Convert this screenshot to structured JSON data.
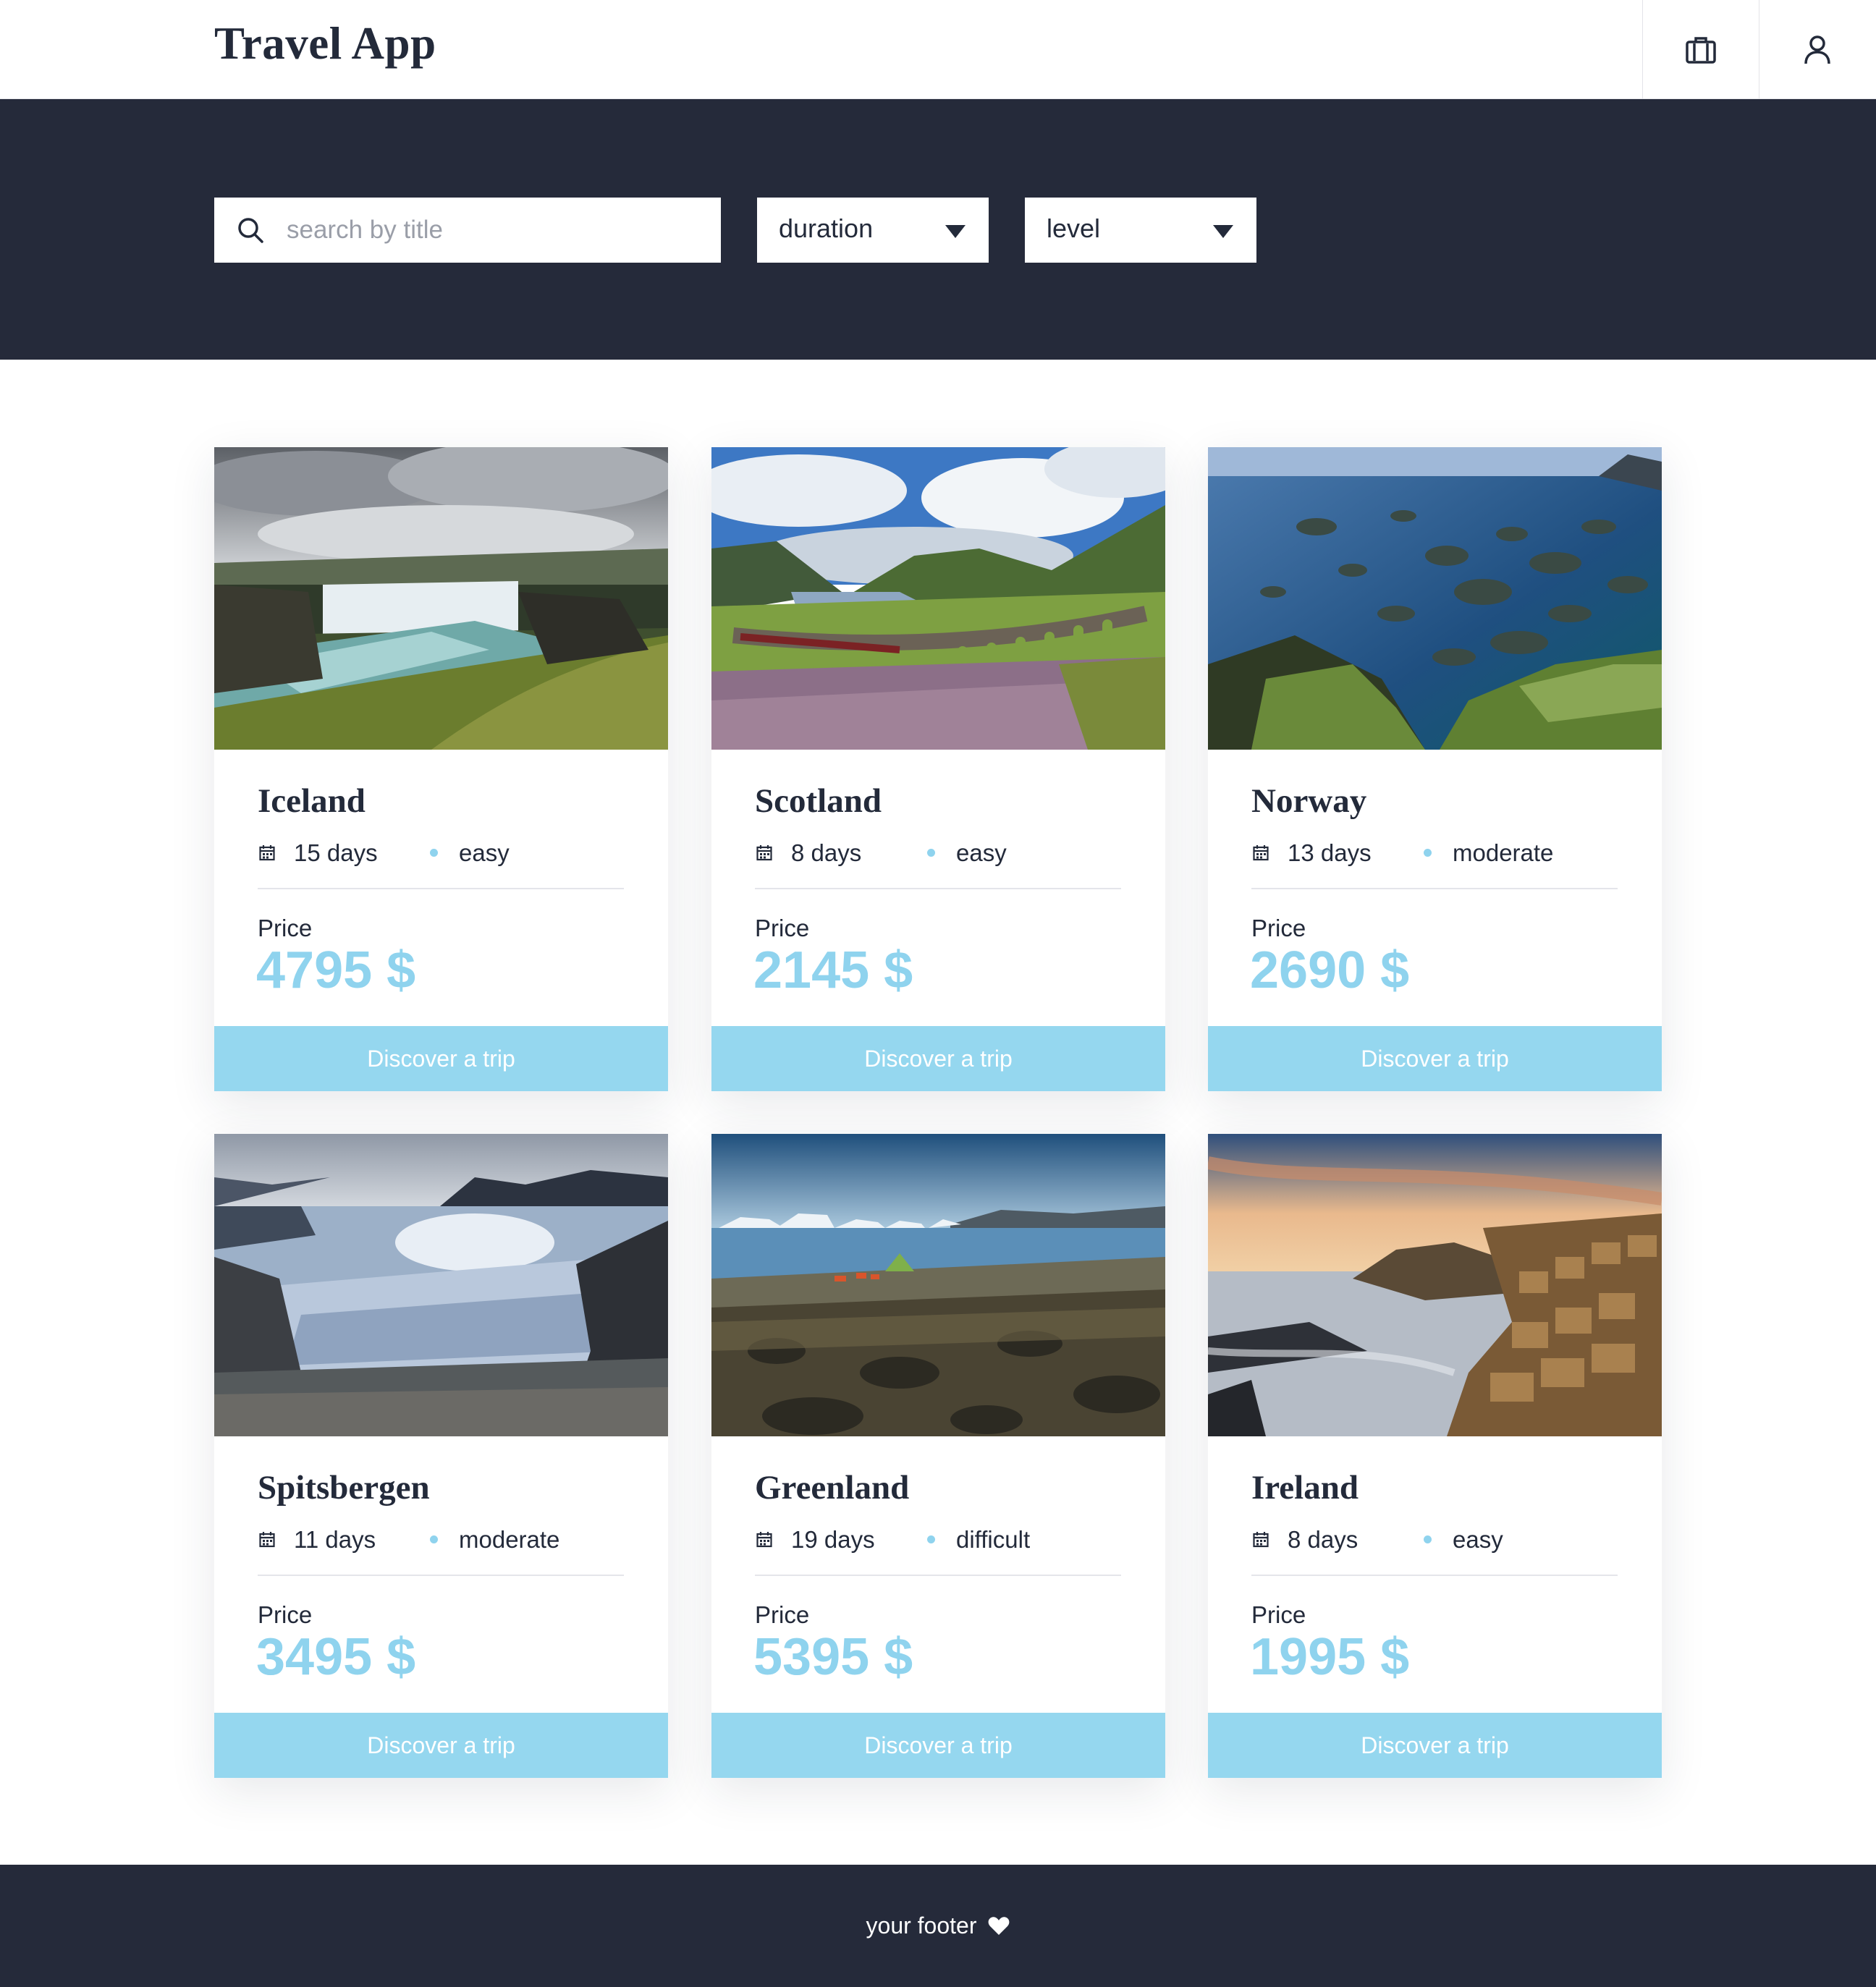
{
  "header": {
    "title": "Travel App",
    "briefcase_icon": "briefcase-icon",
    "user_icon": "user-icon"
  },
  "filters": {
    "search_placeholder": "search by title",
    "duration_label": "duration",
    "level_label": "level"
  },
  "colors": {
    "dark": "#252a3a",
    "accent": "#95d7ef",
    "price": "#8fd3ee"
  },
  "trips": [
    {
      "title": "Iceland",
      "days": "15 days",
      "level": "easy",
      "price_label": "Price",
      "price": "4795 $",
      "cta": "Discover a trip"
    },
    {
      "title": "Scotland",
      "days": "8 days",
      "level": "easy",
      "price_label": "Price",
      "price": "2145 $",
      "cta": "Discover a trip"
    },
    {
      "title": "Norway",
      "days": "13 days",
      "level": "moderate",
      "price_label": "Price",
      "price": "2690 $",
      "cta": "Discover a trip"
    },
    {
      "title": "Spitsbergen",
      "days": "11 days",
      "level": "moderate",
      "price_label": "Price",
      "price": "3495 $",
      "cta": "Discover a trip"
    },
    {
      "title": "Greenland",
      "days": "19 days",
      "level": "difficult",
      "price_label": "Price",
      "price": "5395 $",
      "cta": "Discover a trip"
    },
    {
      "title": "Ireland",
      "days": "8 days",
      "level": "easy",
      "price_label": "Price",
      "price": "1995 $",
      "cta": "Discover a trip"
    }
  ],
  "footer": {
    "text": "your footer",
    "icon": "heart-icon"
  }
}
